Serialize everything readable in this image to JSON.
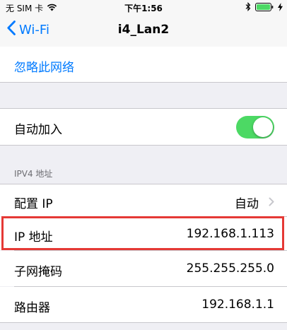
{
  "status_bar": {
    "carrier": "无 SIM 卡",
    "time": "下午1:56"
  },
  "nav": {
    "back_label": "Wi-Fi",
    "title": "i4_Lan2"
  },
  "forget_network": "忽略此网络",
  "auto_join": {
    "label": "自动加入",
    "enabled": true
  },
  "ipv4": {
    "header": "IPV4 地址",
    "configure_ip": {
      "label": "配置 IP",
      "value": "自动"
    },
    "ip_address": {
      "label": "IP 地址",
      "value": "192.168.1.113"
    },
    "subnet_mask": {
      "label": "子网掩码",
      "value": "255.255.255.0"
    },
    "router": {
      "label": "路由器",
      "value": "192.168.1.1"
    }
  },
  "colors": {
    "accent": "#007aff",
    "toggle_on": "#4cd964",
    "highlight": "#e53935"
  }
}
